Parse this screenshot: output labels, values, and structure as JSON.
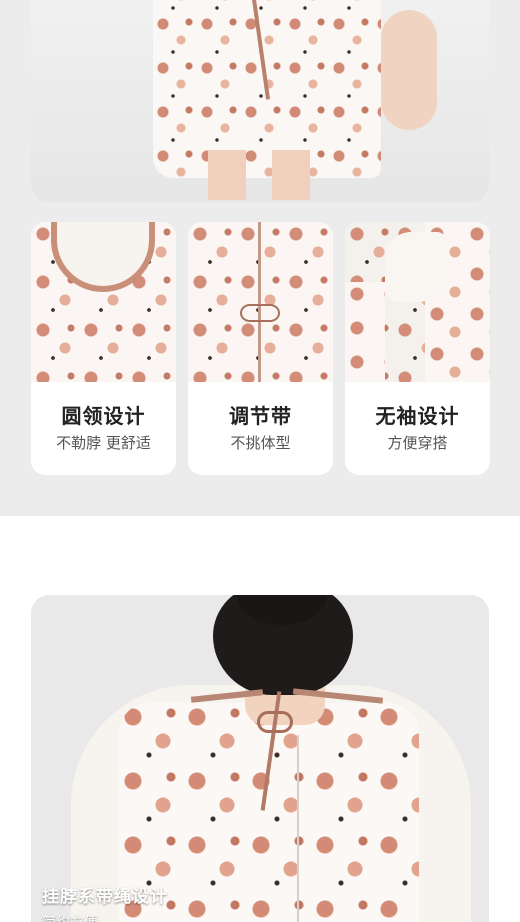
{
  "features": [
    {
      "title": "圆领设计",
      "subtitle": "不勒脖 更舒适"
    },
    {
      "title": "调节带",
      "subtitle": "不挑体型"
    },
    {
      "title": "无袖设计",
      "subtitle": "方便穿搭"
    }
  ],
  "back_detail": {
    "caption_title": "挂脖系带绳设计",
    "caption_sub": "简约方便"
  },
  "colors": {
    "pattern_main": "#d08a76",
    "pattern_light": "#e8b4a0",
    "tie_brown": "#b9806c",
    "page_bg": "#ececec",
    "card_bg": "#ffffff"
  }
}
